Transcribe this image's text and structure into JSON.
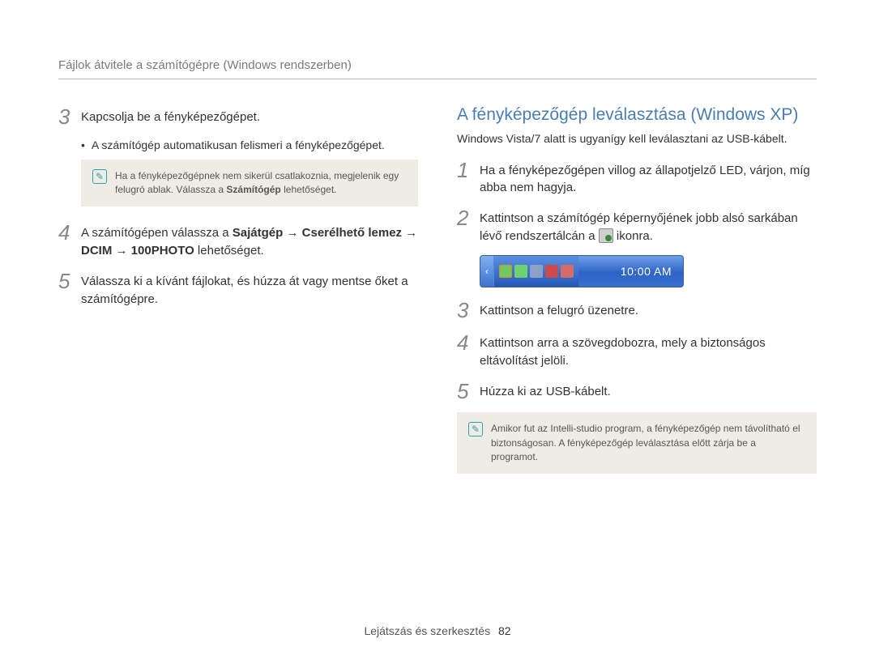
{
  "header": {
    "title": "Fájlok átvitele a számítógépre (Windows rendszerben)"
  },
  "left": {
    "steps": {
      "s3": {
        "num": "3",
        "text": "Kapcsolja be a fényképezőgépet."
      },
      "s3_bullet": "A számítógép automatikusan felismeri a fényképezőgépet.",
      "s3_note_a": "Ha a fényképezőgépnek nem sikerül csatlakoznia, megjelenik egy felugró ablak. Válassza a ",
      "s3_note_b": "Számítógép",
      "s3_note_c": " lehetőséget.",
      "s4": {
        "num": "4",
        "a": "A számítógépen válassza a ",
        "b": "Sajátgép",
        "arrow1": " → ",
        "c": "Cserélhető lemez",
        "arrow2": " → ",
        "d": "DCIM",
        "arrow3": " → ",
        "e": "100PHOTO",
        "f": " lehetőséget."
      },
      "s5": {
        "num": "5",
        "text": "Válassza ki a kívánt fájlokat, és húzza át vagy mentse őket a számítógépre."
      }
    }
  },
  "right": {
    "heading": "A fényképezőgép leválasztása (Windows XP)",
    "subtitle": "Windows Vista/7 alatt is ugyanígy kell leválasztani az USB-kábelt.",
    "steps": {
      "s1": {
        "num": "1",
        "text": "Ha a fényképezőgépen villog az állapotjelző LED, várjon, míg abba nem hagyja."
      },
      "s2": {
        "num": "2",
        "a": "Kattintson a számítógép képernyőjének jobb alsó sarkában lévő rendszertálcán a ",
        "b": " ikonra."
      },
      "s3": {
        "num": "3",
        "text": "Kattintson a felugró üzenetre."
      },
      "s4": {
        "num": "4",
        "text": "Kattintson arra a szövegdobozra, mely a biztonságos eltávolítást jelöli."
      },
      "s5": {
        "num": "5",
        "text": "Húzza ki az USB-kábelt."
      }
    },
    "note": "Amikor fut az Intelli-studio program, a fényképezőgép nem távolítható el biztonságosan. A fényképezőgép leválasztása előtt zárja be a programot.",
    "taskbar": {
      "clock": "10:00 AM"
    }
  },
  "footer": {
    "section": "Lejátszás és szerkesztés",
    "page": "82"
  }
}
